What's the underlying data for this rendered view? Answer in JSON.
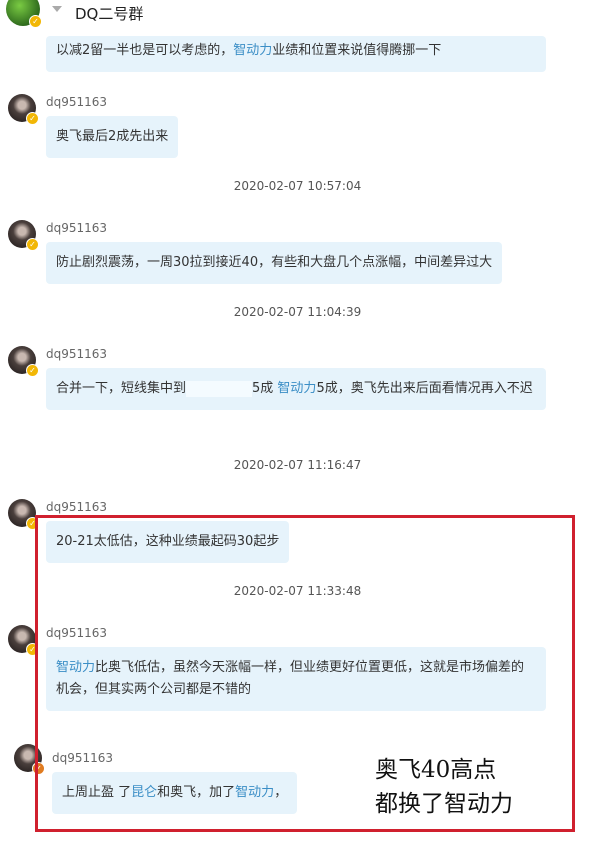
{
  "header": {
    "title": "DQ二号群"
  },
  "messages": [
    {
      "text_a": "以减2留一半也是可以考虑的，",
      "highlight": "智动力",
      "text_b": "业绩和位置来说值得腾挪一下"
    },
    {
      "sender": "dq951163",
      "text": "奥飞最后2成先出来"
    },
    {
      "time": "2020-02-07 10:57:04"
    },
    {
      "sender": "dq951163",
      "text": "防止剧烈震荡，一周30拉到接近40，有些和大盘几个点涨幅，中间差异过大"
    },
    {
      "time": "2020-02-07 11:04:39"
    },
    {
      "sender": "dq951163",
      "text_a": "合并一下，短线集中到",
      "text_b": "5成 ",
      "highlight": "智动力",
      "text_c": "5成，奥飞先出来后面看情况再入不迟"
    },
    {
      "time": "2020-02-07 11:16:47"
    },
    {
      "sender": "dq951163",
      "text": "20-21太低估，这种业绩最起码30起步"
    },
    {
      "time": "2020-02-07 11:33:48"
    },
    {
      "sender": "dq951163",
      "highlight": "智动力",
      "text_a": "比奥飞低估，虽然今天涨幅一样，但业绩更好位置更低，这就是市场偏差的机会，但其实两个公司都是不错的"
    },
    {
      "sender": "dq951163",
      "text_a": "上周止盈 了",
      "highlight_a": "昆仑",
      "text_b": "和奥飞，加了",
      "highlight_b": "智动力",
      "text_c": "，"
    }
  ],
  "annotation": {
    "line1": "奥飞40高点",
    "line2": "都换了智动力"
  },
  "colors": {
    "bubble": "#e6f3fb",
    "highlight": "#3b8ec6",
    "box": "#d0202e"
  }
}
